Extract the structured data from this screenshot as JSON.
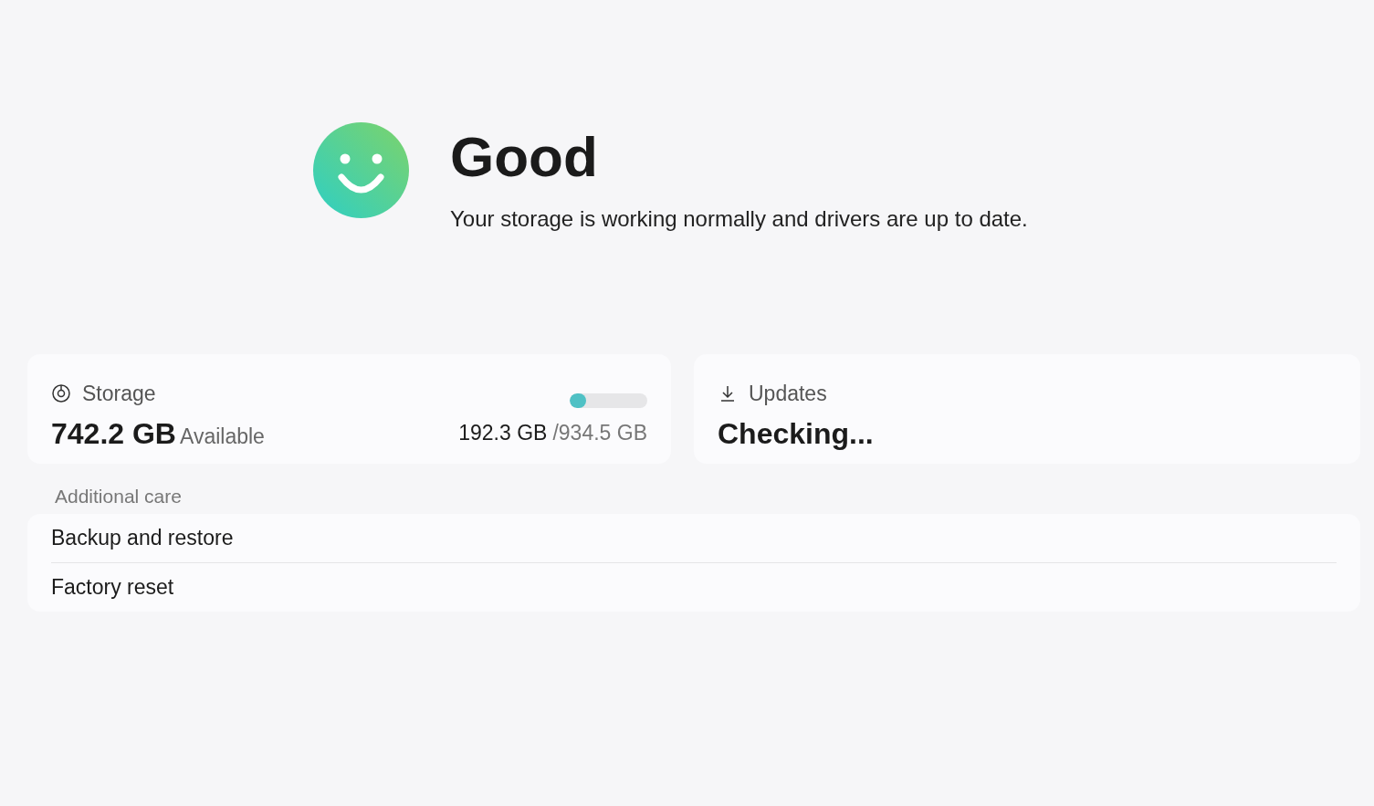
{
  "status": {
    "title": "Good",
    "message": "Your storage is working normally and drivers are up to date."
  },
  "storage": {
    "label": "Storage",
    "available": "742.2 GB",
    "available_label": "Available",
    "used": "192.3 GB",
    "total": "/934.5 GB",
    "level": 0.206
  },
  "updates": {
    "label": "Updates",
    "value": "Checking..."
  },
  "additional_care": {
    "heading": "Additional care",
    "items": [
      "Backup and restore",
      "Factory reset"
    ]
  }
}
